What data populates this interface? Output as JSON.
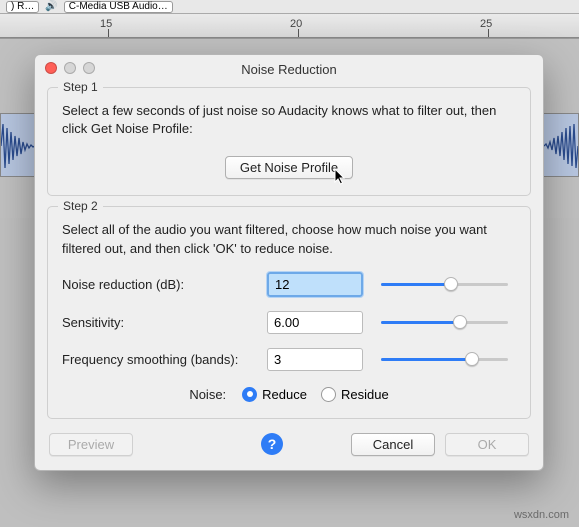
{
  "toolbar": {
    "left_dd": ")  R…",
    "audio_dd": "C-Media USB Audio…"
  },
  "ruler": {
    "ticks": [
      "15",
      "20",
      "25"
    ]
  },
  "modal": {
    "title": "Noise Reduction",
    "step1": {
      "legend": "Step 1",
      "text": "Select a few seconds of just noise so Audacity knows what to filter out, then click Get Noise Profile:",
      "button": "Get Noise Profile"
    },
    "step2": {
      "legend": "Step 2",
      "text": "Select all of the audio you want filtered, choose how much noise you want filtered out, and then click 'OK' to reduce noise.",
      "rows": {
        "noise_reduction": {
          "label": "Noise reduction (dB):",
          "value": "12",
          "slider": 55
        },
        "sensitivity": {
          "label": "Sensitivity:",
          "value": "6.00",
          "slider": 62
        },
        "freq_smoothing": {
          "label": "Frequency smoothing (bands):",
          "value": "3",
          "slider": 72
        }
      },
      "radio": {
        "lead": "Noise:",
        "reduce": "Reduce",
        "residue": "Residue"
      }
    },
    "buttons": {
      "preview": "Preview",
      "help": "?",
      "cancel": "Cancel",
      "ok": "OK"
    }
  },
  "watermark": "wsxdn.com"
}
